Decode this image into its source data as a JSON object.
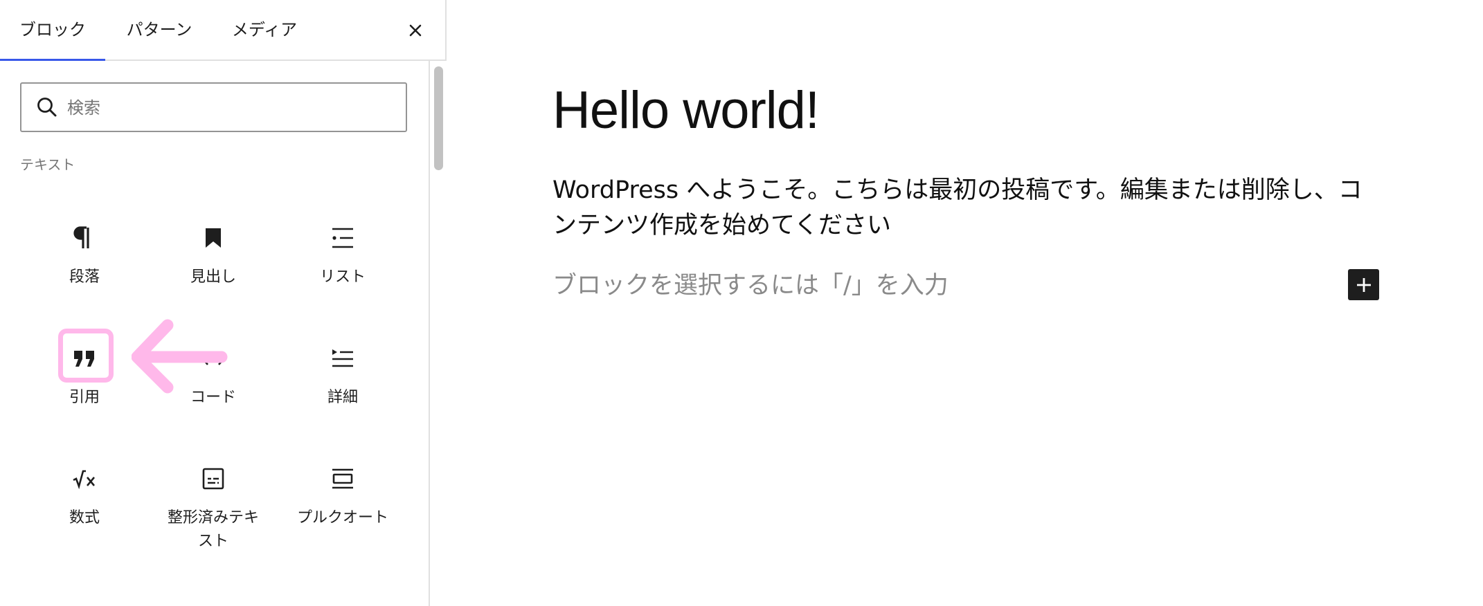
{
  "tabs": {
    "blocks": "ブロック",
    "patterns": "パターン",
    "media": "メディア"
  },
  "search": {
    "placeholder": "検索"
  },
  "category": "テキスト",
  "blocks": [
    {
      "label": "段落",
      "icon": "paragraph-icon"
    },
    {
      "label": "見出し",
      "icon": "heading-icon"
    },
    {
      "label": "リスト",
      "icon": "list-icon"
    },
    {
      "label": "引用",
      "icon": "quote-icon"
    },
    {
      "label": "コード",
      "icon": "code-icon"
    },
    {
      "label": "詳細",
      "icon": "details-icon"
    },
    {
      "label": "数式",
      "icon": "math-icon"
    },
    {
      "label": "整形済みテキスト",
      "icon": "preformatted-icon"
    },
    {
      "label": "プルクオート",
      "icon": "pullquote-icon"
    }
  ],
  "editor": {
    "title": "Hello world!",
    "body": "WordPress へようこそ。こちらは最初の投稿です。編集または削除し、コンテンツ作成を始めてください",
    "placeholder": "ブロックを選択するには「/」を入力"
  },
  "colors": {
    "accent": "#3858e9",
    "highlight": "#ffb8ea",
    "text": "#1e1e1e"
  }
}
